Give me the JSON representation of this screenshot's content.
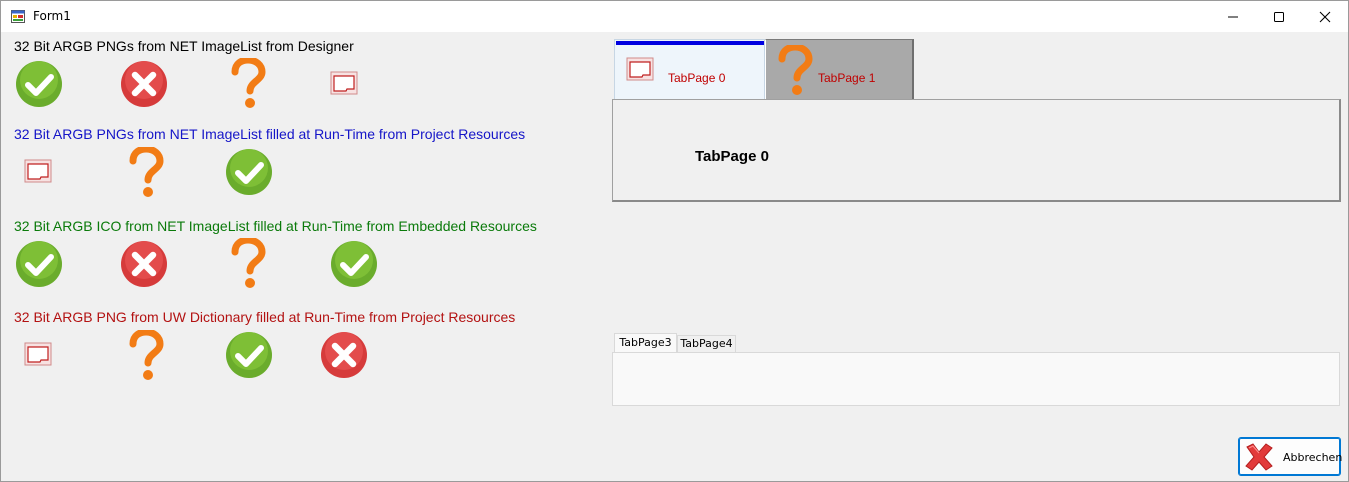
{
  "window": {
    "title": "Form1",
    "icons": {
      "app": "form-app-icon",
      "minimize": "minimize-icon",
      "maximize": "maximize-icon",
      "close": "close-icon"
    }
  },
  "sections": [
    {
      "label": "32 Bit ARGB PNGs from NET ImageList from Designer",
      "color": "#000000",
      "icons": [
        "check-icon",
        "error-icon",
        "question-icon",
        "window-icon"
      ]
    },
    {
      "label": "32 Bit ARGB PNGs from NET ImageList filled at Run-Time from Project Resources",
      "color": "#1515c8",
      "icons": [
        "window-icon",
        "question-icon",
        "check-icon"
      ]
    },
    {
      "label": "32 Bit ARGB ICO from NET ImageList filled at Run-Time from Embedded Resources",
      "color": "#0a7a0a",
      "icons": [
        "check-icon",
        "error-icon",
        "question-icon",
        "check-icon"
      ]
    },
    {
      "label": "32 Bit ARGB PNG from UW Dictionary filled at Run-Time from Project Resources",
      "color": "#b31212",
      "icons": [
        "window-icon",
        "question-icon",
        "check-icon",
        "error-icon"
      ]
    }
  ],
  "main_tabs": {
    "tabs": [
      {
        "label": "TabPage 0",
        "icon": "window-icon",
        "selected": true
      },
      {
        "label": "TabPage 1",
        "icon": "question-icon",
        "selected": false
      }
    ],
    "content_label": "TabPage 0",
    "accent": "#0000e0",
    "tab_text_color": "#c00000"
  },
  "small_tabs": {
    "tabs": [
      {
        "label": "TabPage3",
        "selected": true
      },
      {
        "label": "TabPage4",
        "selected": false
      }
    ]
  },
  "cancel_button": {
    "label": "Abbrechen",
    "icon": "red-x-icon",
    "border": "#0078d4"
  }
}
